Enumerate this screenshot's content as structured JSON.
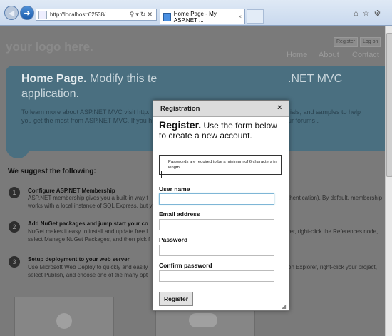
{
  "browser": {
    "address": "http://localhost:62538/",
    "tab_title": "Home Page - My ASP.NET ...",
    "tab_close": "×",
    "toolbar_icons": "⌂☆⚙"
  },
  "page": {
    "logo": "your logo here.",
    "register_link": "Register",
    "login_link": "Log on",
    "menu": [
      "Home",
      "About",
      "Contact"
    ],
    "hero": {
      "title_bold": "Home Page.",
      "title_rest": " Modify this te",
      "title_line2": "application.",
      "title_right": ".NET MVC",
      "para_line1": "To learn more about ASP.NET MVC visit  http:",
      "para_line2": "you get the most from ASP.NET MVC. If you h",
      "right_line1": "rials, and samples  to help",
      "right_line2": "ur forums ."
    },
    "suggest_title": "We suggest the following:",
    "steps": [
      {
        "num": "1",
        "title": "Configure ASP.NET Membership",
        "line1": "ASP.NET membership gives you a built-in way t",
        "line2": "works with a local instance of SQL Express, but y",
        "right1": "thentication). By default, membership",
        "right2": ""
      },
      {
        "num": "2",
        "title": "Add NuGet packages and jump start your co",
        "line1": "NuGet makes it easy to install and update free l",
        "line2": "select Manage NuGet Packages, and then pick f",
        "right1": "rer, right-click the References node,",
        "right2": ""
      },
      {
        "num": "3",
        "title": "Setup deployment to your web server",
        "line1": "Use Microsoft Web Deploy to quickly and easily",
        "line2": "select Publish, and choose one of the many opt",
        "right1": "on Explorer, right-click your project,",
        "right2": ""
      }
    ]
  },
  "dialog": {
    "title": "Registration",
    "close": "×",
    "heading_bold": "Register.",
    "heading_rest": " Use the form below to create a new account.",
    "notice": "Passwords are required to be a minimum of 6 characters in length.",
    "fields": [
      {
        "label": "User name",
        "value": ""
      },
      {
        "label": "Email address",
        "value": ""
      },
      {
        "label": "Password",
        "value": ""
      },
      {
        "label": "Confirm password",
        "value": ""
      }
    ],
    "submit": "Register"
  }
}
